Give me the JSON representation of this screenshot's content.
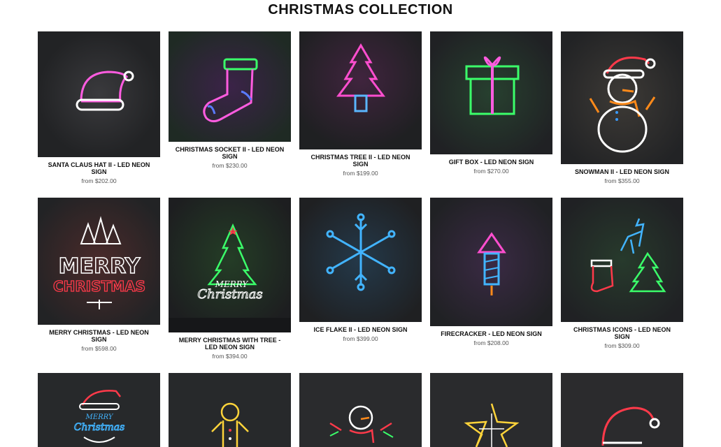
{
  "heading": "CHRISTMAS COLLECTION",
  "products": [
    {
      "name": "SANTA CLAUS HAT II - LED NEON SIGN",
      "price": "from $202.00",
      "icon": "santa-hat-icon"
    },
    {
      "name": "CHRISTMAS SOCKET II - LED NEON SIGN",
      "price": "from $230.00",
      "icon": "stocking-icon"
    },
    {
      "name": "CHRISTMAS TREE II - LED NEON SIGN",
      "price": "from $199.00",
      "icon": "tree-icon"
    },
    {
      "name": "GIFT BOX - LED NEON SIGN",
      "price": "from $270.00",
      "icon": "gift-box-icon"
    },
    {
      "name": "SNOWMAN II - LED NEON SIGN",
      "price": "from $355.00",
      "icon": "snowman-icon"
    },
    {
      "name": "MERRY CHRISTMAS - LED NEON SIGN",
      "price": "from $598.00",
      "icon": "merry-christmas-icon",
      "text_a": "MERRY",
      "text_b": "CHRISTMAS"
    },
    {
      "name": "MERRY CHRISTMAS WITH TREE - LED NEON SIGN",
      "price": "from $394.00",
      "icon": "tree-with-text-icon",
      "text_a": "MERRY",
      "text_b": "Christmas"
    },
    {
      "name": "ICE FLAKE II - LED NEON SIGN",
      "price": "from $399.00",
      "icon": "snowflake-icon"
    },
    {
      "name": "FIRECRACKER - LED NEON SIGN",
      "price": "from $208.00",
      "icon": "firecracker-icon"
    },
    {
      "name": "CHRISTMAS ICONS - LED NEON SIGN",
      "price": "from $309.00",
      "icon": "christmas-icons-icon"
    },
    {
      "icon": "santa-merry-christmas-icon",
      "text_a": "MERRY",
      "text_b": "Christmas"
    },
    {
      "icon": "gingerbread-icon"
    },
    {
      "icon": "snowman-scarf-icon"
    },
    {
      "icon": "star-icon"
    },
    {
      "icon": "santa-hat-icon"
    }
  ]
}
